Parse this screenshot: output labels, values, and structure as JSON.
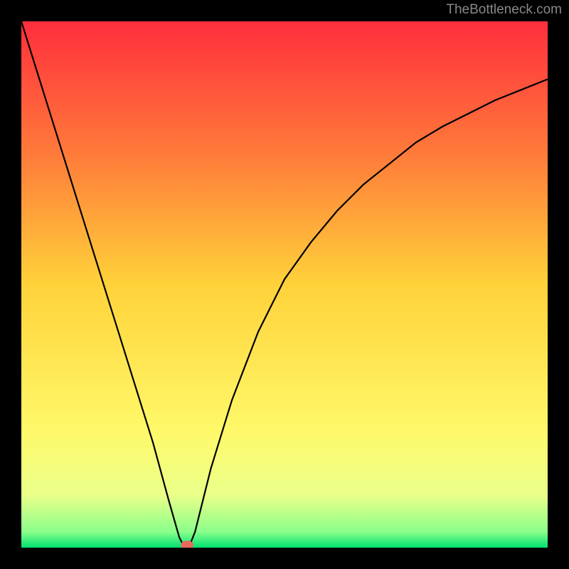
{
  "watermark": "TheBottleneck.com",
  "chart_data": {
    "type": "line",
    "title": "",
    "xlabel": "",
    "ylabel": "",
    "xlim": [
      0,
      100
    ],
    "ylim": [
      0,
      100
    ],
    "x": [
      0,
      5,
      10,
      15,
      20,
      25,
      28,
      30,
      31,
      32,
      33,
      34,
      36,
      40,
      45,
      50,
      55,
      60,
      65,
      70,
      75,
      80,
      85,
      90,
      95,
      100
    ],
    "values": [
      100,
      84,
      68,
      52,
      36,
      20,
      9,
      2,
      0,
      0.5,
      3,
      7,
      15,
      28,
      41,
      51,
      58,
      64,
      69,
      73,
      77,
      80,
      82.5,
      85,
      87,
      89
    ],
    "min_point": {
      "x": 31,
      "y": 0
    },
    "marker": {
      "x": 31.5,
      "y": 0.5,
      "color": "#e86a5c"
    },
    "background_gradient": {
      "type": "vertical",
      "stops": [
        {
          "pos": 0.0,
          "color": "#ff2e3d"
        },
        {
          "pos": 0.25,
          "color": "#ff7a3a"
        },
        {
          "pos": 0.5,
          "color": "#ffd23a"
        },
        {
          "pos": 0.78,
          "color": "#fff96a"
        },
        {
          "pos": 0.9,
          "color": "#eaff8a"
        },
        {
          "pos": 0.97,
          "color": "#8aff8a"
        },
        {
          "pos": 1.0,
          "color": "#00e070"
        }
      ]
    },
    "series_color": "#000000"
  }
}
